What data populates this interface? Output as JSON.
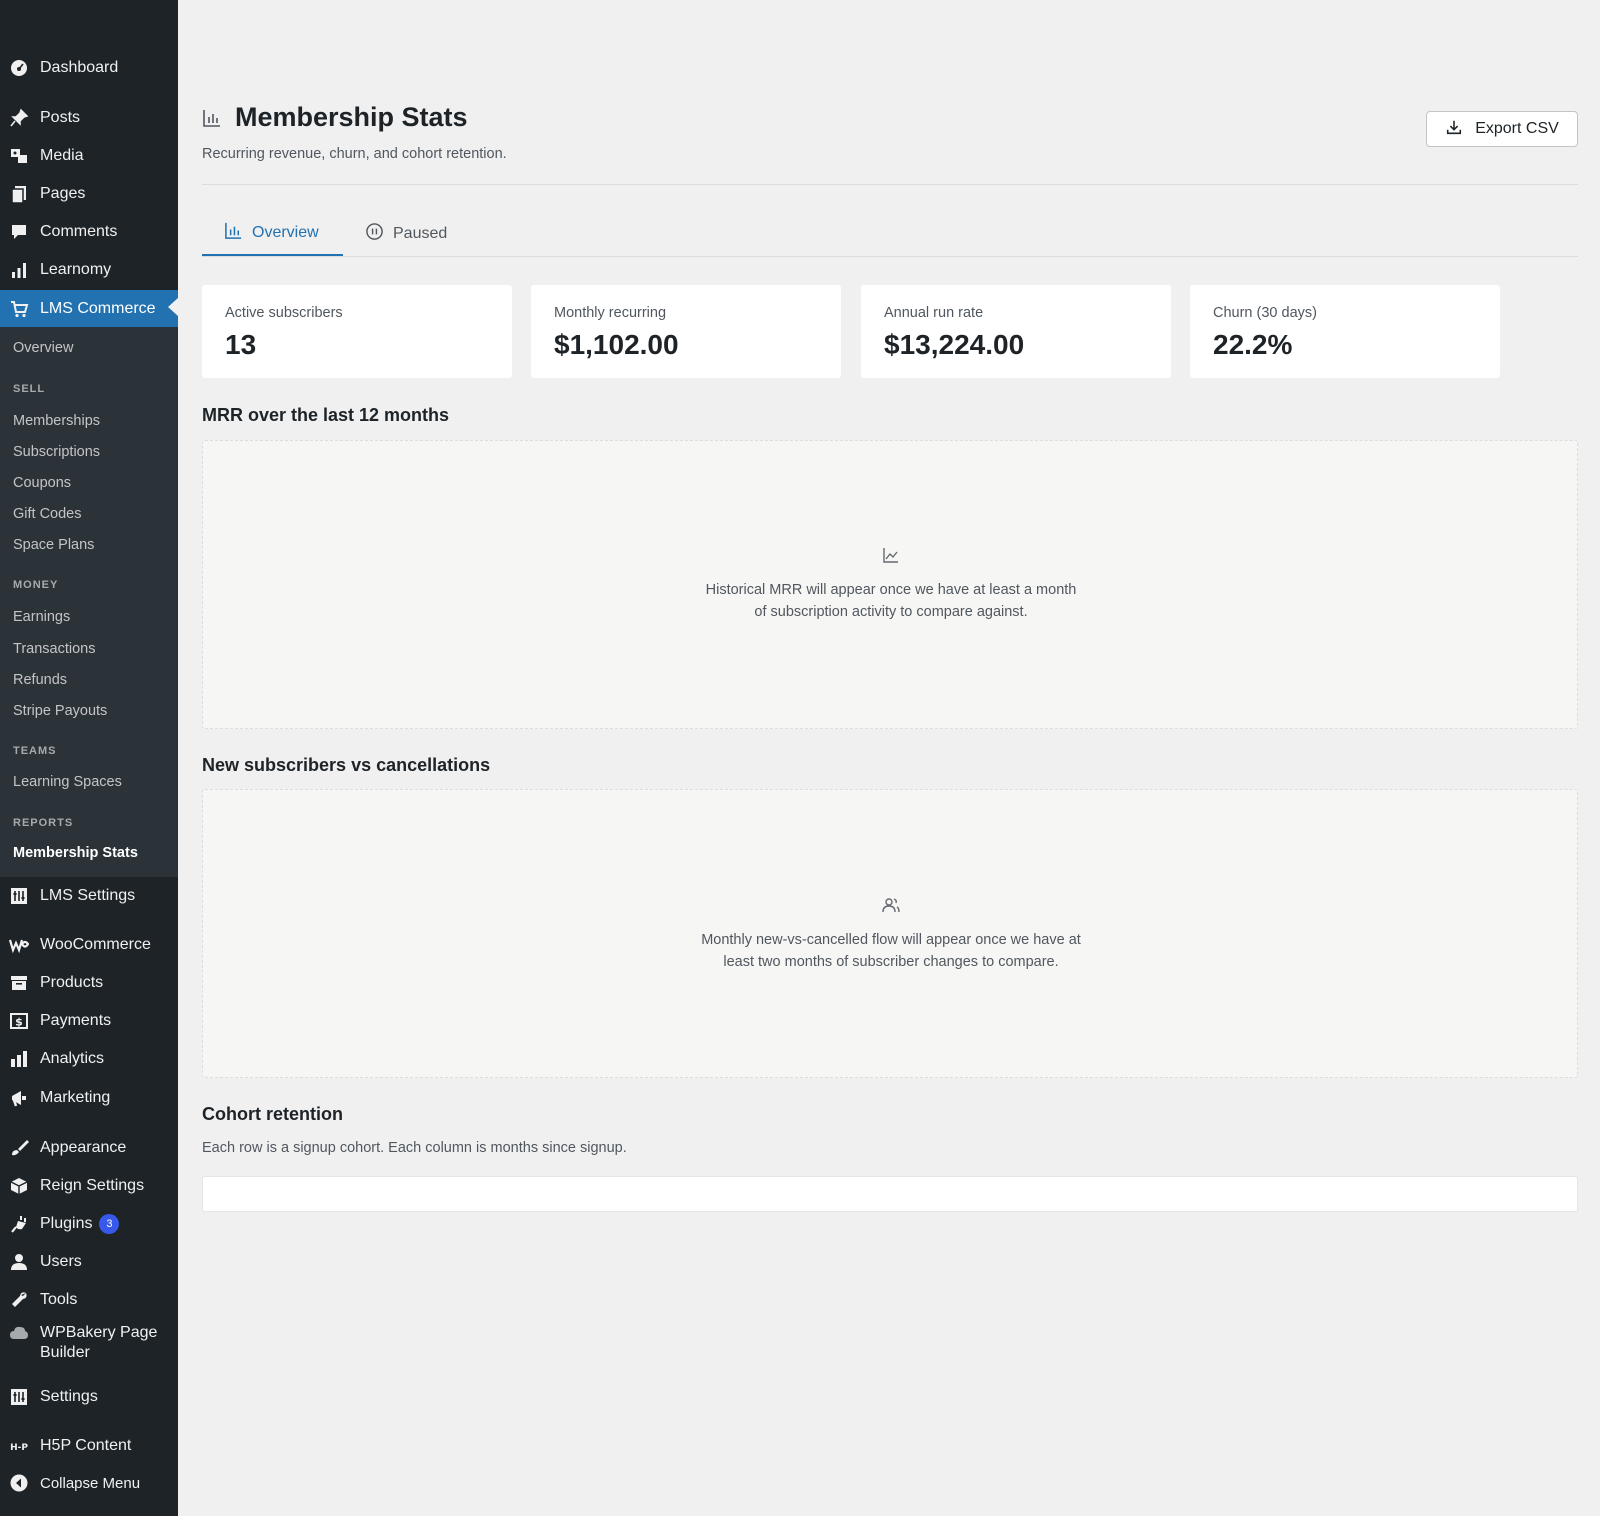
{
  "sidebar": {
    "dashboard": "Dashboard",
    "posts": "Posts",
    "media": "Media",
    "pages": "Pages",
    "comments": "Comments",
    "learnomy": "Learnomy",
    "lms_commerce": "LMS Commerce",
    "submenu": {
      "overview": "Overview",
      "sell_head": "SELL",
      "memberships": "Memberships",
      "subscriptions": "Subscriptions",
      "coupons": "Coupons",
      "gift_codes": "Gift Codes",
      "space_plans": "Space Plans",
      "money_head": "MONEY",
      "earnings": "Earnings",
      "transactions": "Transactions",
      "refunds": "Refunds",
      "stripe_payouts": "Stripe Payouts",
      "teams_head": "TEAMS",
      "learning_spaces": "Learning Spaces",
      "reports_head": "REPORTS",
      "membership_stats": "Membership Stats"
    },
    "lms_settings": "LMS Settings",
    "woocommerce": "WooCommerce",
    "products": "Products",
    "payments": "Payments",
    "analytics": "Analytics",
    "marketing": "Marketing",
    "appearance": "Appearance",
    "reign_settings": "Reign Settings",
    "plugins": "Plugins",
    "plugins_badge": "3",
    "users": "Users",
    "tools": "Tools",
    "wpbakery_line1": "WPBakery Page",
    "wpbakery_line2": "Builder",
    "settings": "Settings",
    "h5p": "H5P Content",
    "collapse": "Collapse Menu"
  },
  "header": {
    "title": "Membership Stats",
    "subtitle": "Recurring revenue, churn, and cohort retention.",
    "export_label": "Export CSV"
  },
  "tabs": {
    "overview": "Overview",
    "paused": "Paused"
  },
  "stats": [
    {
      "label": "Active subscribers",
      "value": "13"
    },
    {
      "label": "Monthly recurring",
      "value": "$1,102.00"
    },
    {
      "label": "Annual run rate",
      "value": "$13,224.00"
    },
    {
      "label": "Churn (30 days)",
      "value": "22.2%"
    }
  ],
  "mrr": {
    "title": "MRR over the last 12 months",
    "empty_line1": "Historical MRR will appear once we have at least a month",
    "empty_line2": "of subscription activity to compare against."
  },
  "flow": {
    "title": "New subscribers vs cancellations",
    "empty_line1": "Monthly new-vs-cancelled flow will appear once we have at",
    "empty_line2": "least two months of subscriber changes to compare."
  },
  "cohort": {
    "title": "Cohort retention",
    "note": "Each row is a signup cohort. Each column is months since signup."
  },
  "colors": {
    "sidebar_bg": "#1d2327",
    "accent": "#2271b1",
    "badge": "#3858e9"
  }
}
